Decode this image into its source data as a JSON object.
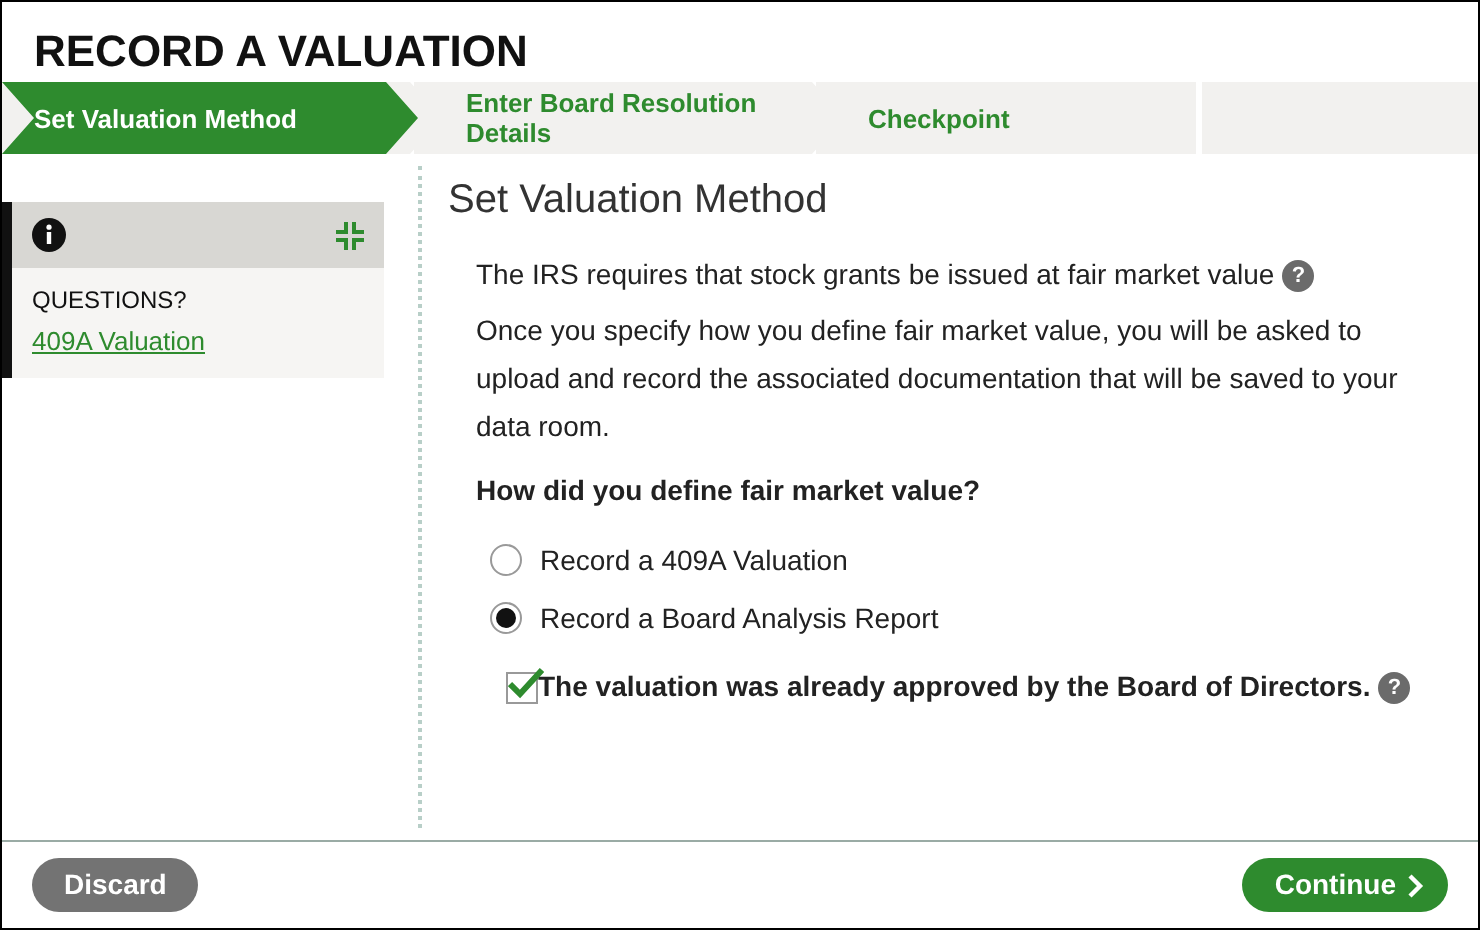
{
  "title": "RECORD A VALUATION",
  "steps": [
    {
      "label": "Set Valuation Method",
      "selected": true
    },
    {
      "label": "Enter Board Resolution Details",
      "selected": false
    },
    {
      "label": "Checkpoint",
      "selected": false
    }
  ],
  "sidebar": {
    "heading": "QUESTIONS?",
    "link": "409A Valuation"
  },
  "main": {
    "heading": "Set Valuation Method",
    "intro": "The IRS requires that stock grants be issued at fair market value",
    "help_mark": "?",
    "body": "Once you specify how you define fair market value, you will be asked to upload and record the associated documentation that will be saved to your data room.",
    "question": "How did you define fair market value?",
    "options": [
      {
        "label": "Record a 409A Valuation",
        "selected": false
      },
      {
        "label": "Record a Board Analysis Report",
        "selected": true
      }
    ],
    "approval": {
      "label": "The valuation was already approved by the Board of Directors.",
      "help_mark": "?",
      "checked": true
    }
  },
  "buttons": {
    "discard": "Discard",
    "continue": "Continue"
  }
}
